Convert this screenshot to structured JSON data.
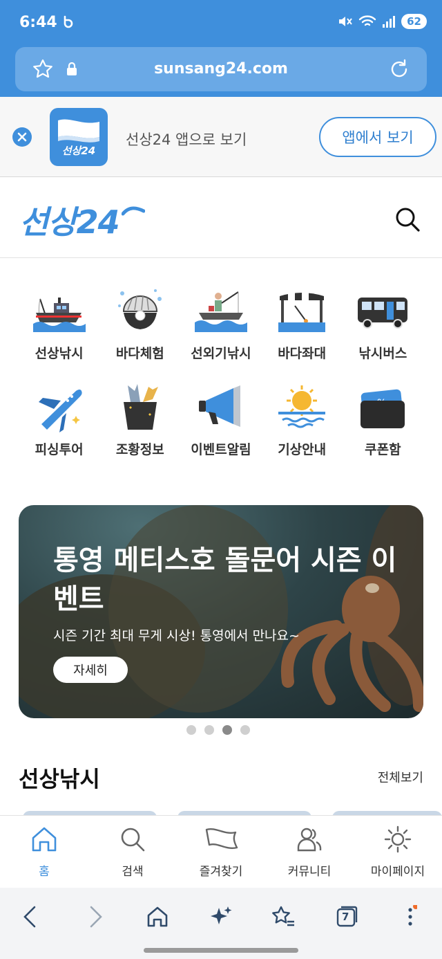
{
  "status_bar": {
    "time": "6:44",
    "battery": "62"
  },
  "url_bar": {
    "url": "sunsang24.com"
  },
  "app_banner": {
    "icon_text": "선상24",
    "text": "선상24 앱으로 보기",
    "open_label": "앱에서 보기"
  },
  "header": {
    "logo": "선상24"
  },
  "categories": [
    {
      "label": "선상낚시",
      "icon": "fishing-boat-icon"
    },
    {
      "label": "바다체험",
      "icon": "pearl-shell-icon"
    },
    {
      "label": "선외기낚시",
      "icon": "small-boat-angler-icon"
    },
    {
      "label": "바다좌대",
      "icon": "sea-platform-icon"
    },
    {
      "label": "낚시버스",
      "icon": "bus-icon"
    },
    {
      "label": "피싱투어",
      "icon": "airplane-icon"
    },
    {
      "label": "조황정보",
      "icon": "fish-bucket-icon"
    },
    {
      "label": "이벤트알림",
      "icon": "megaphone-icon"
    },
    {
      "label": "기상안내",
      "icon": "sun-sea-icon"
    },
    {
      "label": "쿠폰함",
      "icon": "coupon-icon"
    }
  ],
  "promo": {
    "title": "통영 메티스호 돌문어 시즌 이벤트",
    "subtitle": "시즌 기간 최대 무게 시상! 통영에서 만나요~",
    "button": "자세히",
    "slide_index": 3,
    "slide_count": 4
  },
  "section": {
    "title": "선상낚시",
    "more": "전체보기"
  },
  "tabs": [
    {
      "label": "홈",
      "icon": "home-icon",
      "active": true
    },
    {
      "label": "검색",
      "icon": "search-icon",
      "active": false
    },
    {
      "label": "즐겨찾기",
      "icon": "flag-icon",
      "active": false
    },
    {
      "label": "커뮤니티",
      "icon": "people-icon",
      "active": false
    },
    {
      "label": "마이페이지",
      "icon": "gear-icon",
      "active": false
    }
  ],
  "browser_nav": {
    "tab_count": "7"
  },
  "colors": {
    "brand": "#3f8fdc",
    "status_bar": "#3f8fdc",
    "url_bar": "#6aa9e6"
  }
}
